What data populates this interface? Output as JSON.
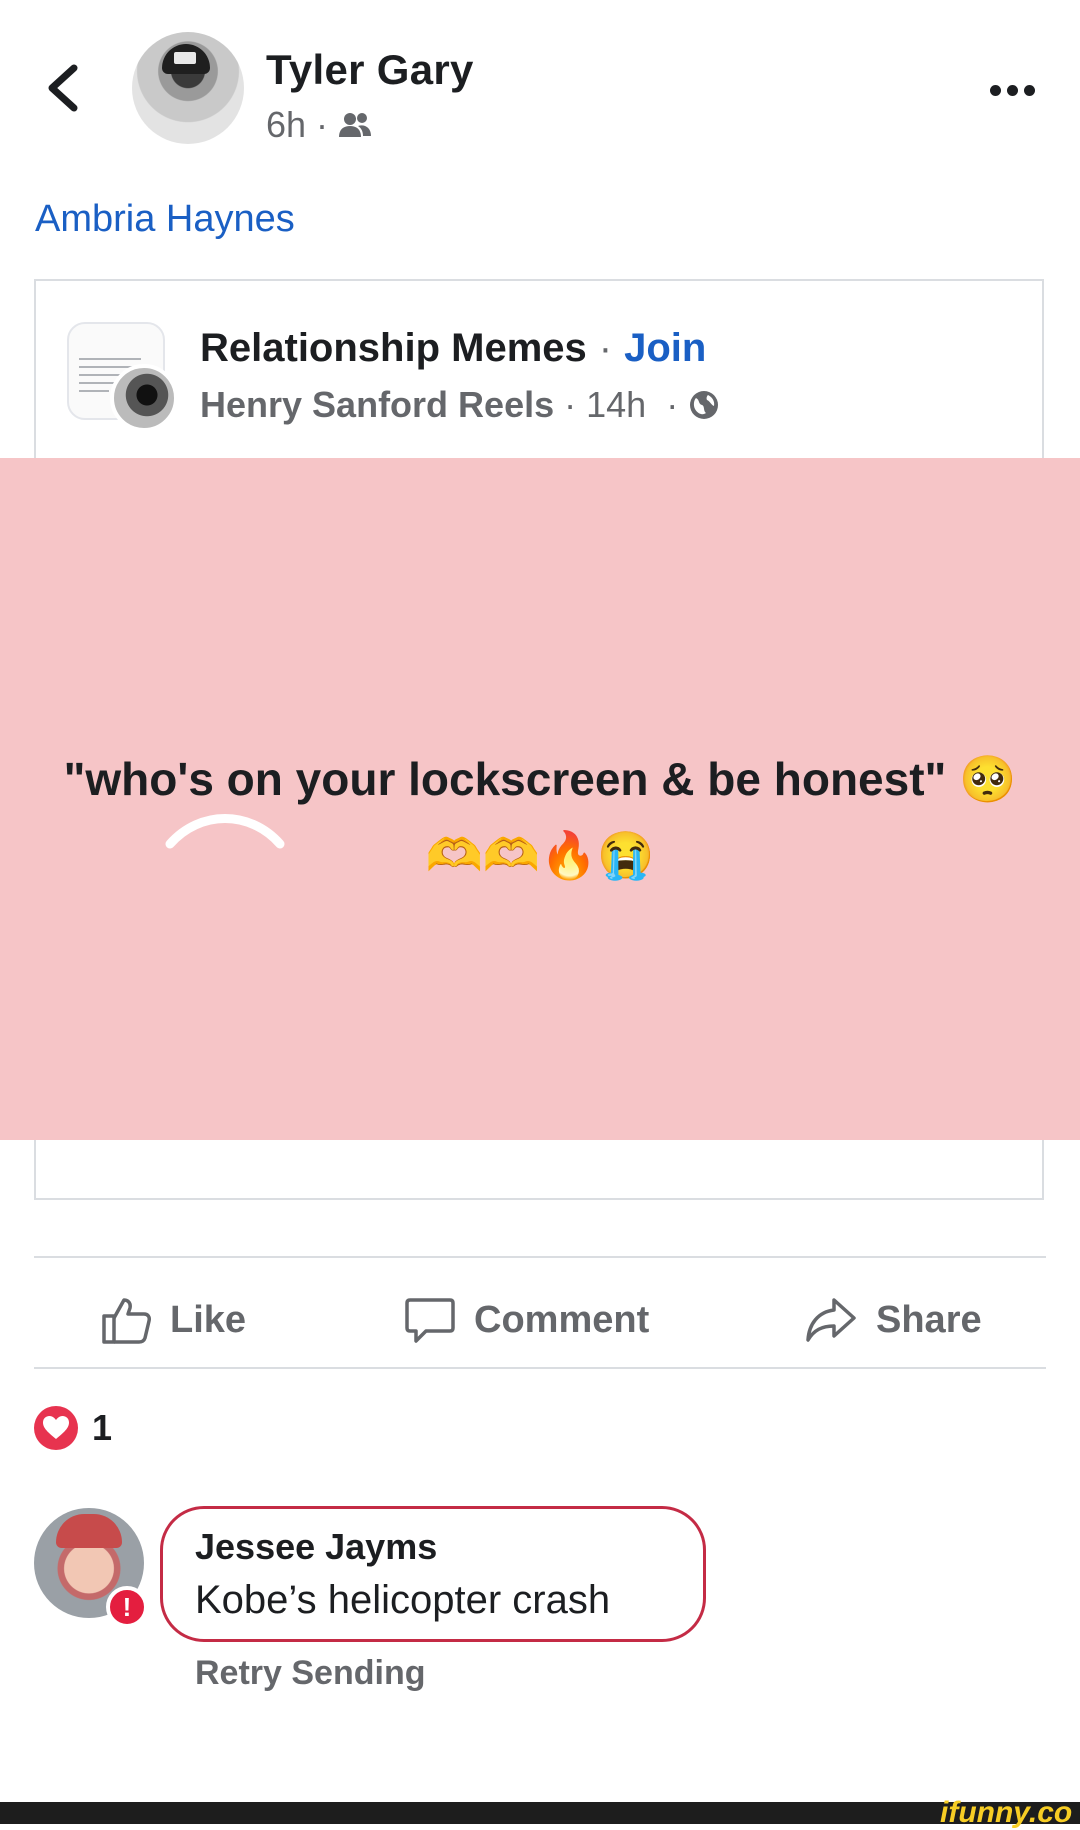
{
  "header": {
    "author_name": "Tyler Gary",
    "time": "6h",
    "separator": "·"
  },
  "tagged_user": "Ambria Haynes",
  "shared_post": {
    "group_name": "Relationship Memes",
    "separator": "·",
    "join_label": "Join",
    "source_name": "Henry Sanford Reels",
    "time": "14h",
    "media_background": "#f6c5c7",
    "quote_text": "\"who's on your lockscreen & be honest\" 🥺",
    "emoji_line": "🫶🫶🔥😭"
  },
  "actions": {
    "like_label": "Like",
    "comment_label": "Comment",
    "share_label": "Share"
  },
  "reactions": {
    "count": "1"
  },
  "comment": {
    "author": "Jessee Jayms",
    "text": "Kobe’s helicopter crash",
    "status": "Retry Sending"
  },
  "watermark": "ifunny.co",
  "colors": {
    "link_blue": "#1a5fc4",
    "error_red": "#e41e3f",
    "secondary_text": "#65676b"
  }
}
